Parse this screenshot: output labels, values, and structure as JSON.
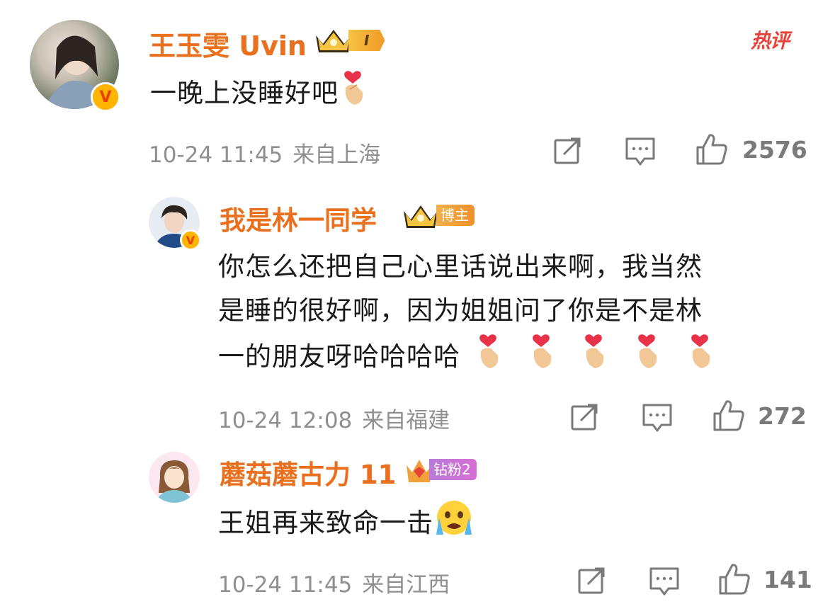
{
  "hot_badge": "热评",
  "comments": [
    {
      "username": "王玉雯 Uvin",
      "level_tag": "I",
      "text": "一晚上没睡好吧",
      "emoji": "finger-heart",
      "time": "10-24 11:45",
      "source": "来自上海",
      "likes": "2576"
    },
    {
      "username": "我是林一同学",
      "level_tag": "博主",
      "text_lines": [
        "你怎么还把自己心里话说出来啊，我当然",
        "是睡的很好啊，因为姐姐问了你是不是林",
        "一的朋友呀哈哈哈哈"
      ],
      "emoji": "finger-heart",
      "emoji_count": 5,
      "time": "10-24 12:08",
      "source": "来自福建",
      "likes": "272"
    },
    {
      "username": "蘑菇蘑古力 11",
      "level_tag": "钻粉2",
      "text": "王姐再来致命一击",
      "emoji": "crying-face",
      "time": "10-24 11:45",
      "source": "来自江西",
      "likes": "141"
    }
  ],
  "icons": {
    "share": "share-icon",
    "comment": "comment-icon",
    "like": "thumbs-up-icon"
  },
  "colors": {
    "username": "#e8701e",
    "meta": "#8f8f8f",
    "hot": "#e8433a",
    "verified": "#ffb400",
    "tag_blogger": "#f0a23a",
    "tag_fan": "#c36be0"
  }
}
